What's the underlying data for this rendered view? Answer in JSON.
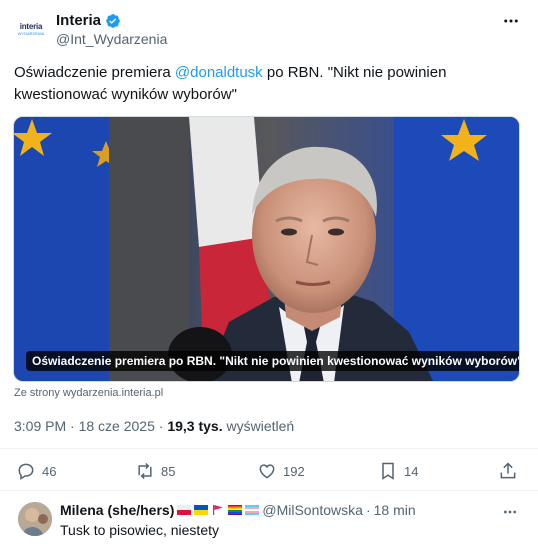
{
  "author": {
    "avatar_logo": "interia",
    "avatar_sub": "WYDARZENIA",
    "name": "Interia",
    "handle": "@Int_Wydarzenia",
    "verified_icon": "verified-badge-icon"
  },
  "tweet": {
    "text_before": "Oświadczenie premiera ",
    "mention": "@donaldtusk",
    "text_after": " po RBN. \"Nikt nie powinien kwestionować wyników wyborów\""
  },
  "media": {
    "caption": "Oświadczenie premiera po RBN. \"Nikt nie powinien kwestionować wyników wyborów\"",
    "source": "Ze strony wydarzenia.interia.pl"
  },
  "meta": {
    "time": "3:09 PM",
    "sep1": " · ",
    "date": "18 cze 2025",
    "sep2": " · ",
    "views_count": "19,3 tys.",
    "views_label": " wyświetleń"
  },
  "actions": {
    "replies": "46",
    "reposts": "85",
    "likes": "192",
    "bookmarks": "14"
  },
  "reply": {
    "name": "Milena (she/hers)",
    "handle": "@MilSontowska",
    "sep": " · ",
    "time": "18 min",
    "text": "Tusk to pisowiec, niestety"
  },
  "colors": {
    "accent": "#1d9bf0",
    "muted": "#536471"
  }
}
